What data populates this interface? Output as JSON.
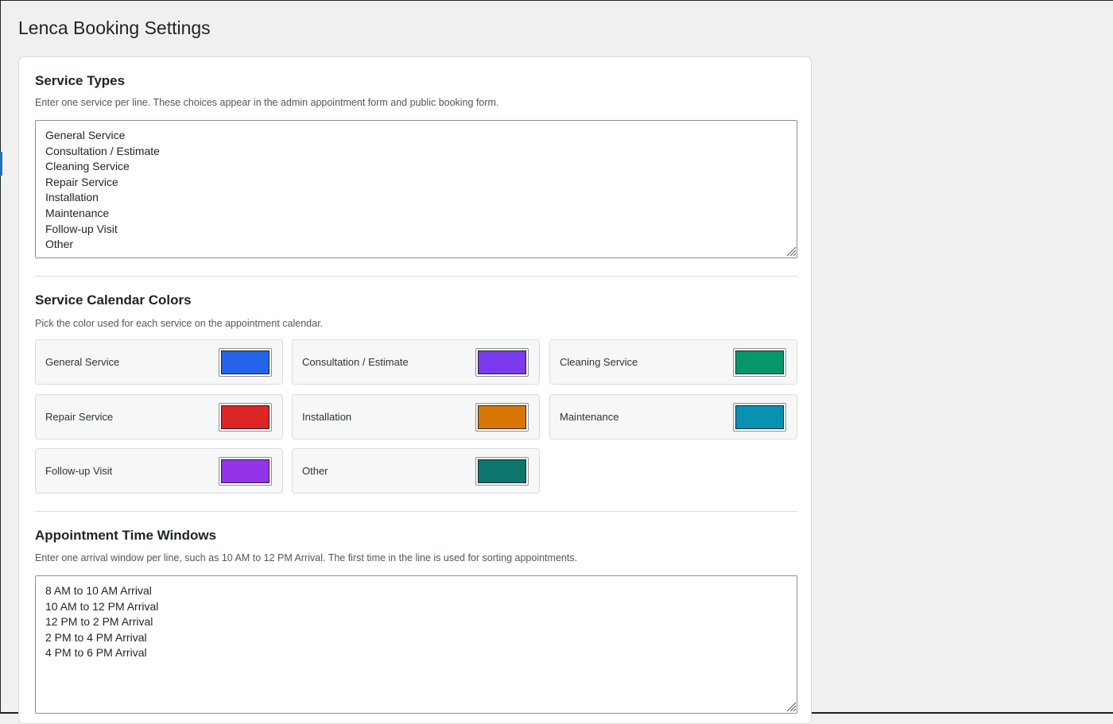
{
  "page": {
    "title": "Lenca Booking Settings"
  },
  "service_types": {
    "title": "Service Types",
    "description": "Enter one service per line. These choices appear in the admin appointment form and public booking form.",
    "value": "General Service\nConsultation / Estimate\nCleaning Service\nRepair Service\nInstallation\nMaintenance\nFollow-up Visit\nOther"
  },
  "service_colors": {
    "title": "Service Calendar Colors",
    "description": "Pick the color used for each service on the appointment calendar.",
    "items": [
      {
        "label": "General Service",
        "color": "#2563eb"
      },
      {
        "label": "Consultation / Estimate",
        "color": "#7c3aed"
      },
      {
        "label": "Cleaning Service",
        "color": "#059669"
      },
      {
        "label": "Repair Service",
        "color": "#dc2626"
      },
      {
        "label": "Installation",
        "color": "#d97706"
      },
      {
        "label": "Maintenance",
        "color": "#0891b2"
      },
      {
        "label": "Follow-up Visit",
        "color": "#9333ea"
      },
      {
        "label": "Other",
        "color": "#0f766e"
      }
    ]
  },
  "time_windows": {
    "title": "Appointment Time Windows",
    "description": "Enter one arrival window per line, such as 10 AM to 12 PM Arrival. The first time in the line is used for sorting appointments.",
    "value": "8 AM to 10 AM Arrival\n10 AM to 12 PM Arrival\n12 PM to 2 PM Arrival\n2 PM to 4 PM Arrival\n4 PM to 6 PM Arrival"
  }
}
